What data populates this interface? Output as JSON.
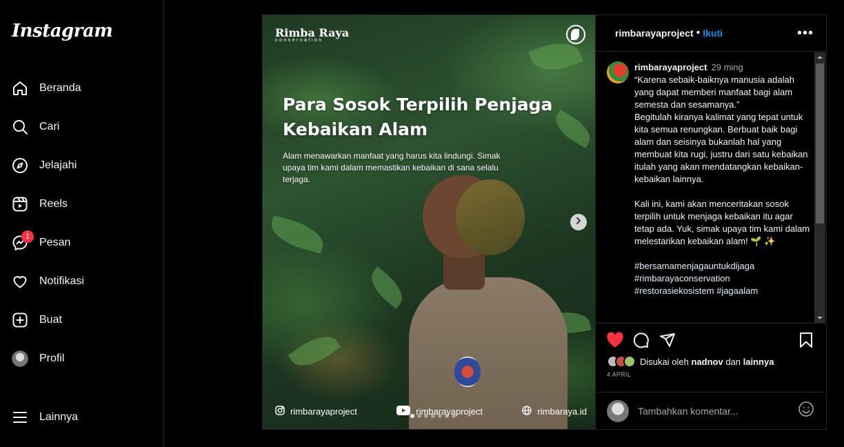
{
  "app": {
    "logo": "Instagram"
  },
  "nav": {
    "items": [
      {
        "label": "Beranda",
        "icon": "home-icon"
      },
      {
        "label": "Cari",
        "icon": "search-icon"
      },
      {
        "label": "Jelajahi",
        "icon": "compass-icon"
      },
      {
        "label": "Reels",
        "icon": "reels-icon"
      },
      {
        "label": "Pesan",
        "icon": "messenger-icon",
        "badge": "1"
      },
      {
        "label": "Notifikasi",
        "icon": "heart-icon"
      },
      {
        "label": "Buat",
        "icon": "plus-square-icon"
      },
      {
        "label": "Profil",
        "icon": "avatar"
      }
    ],
    "more": "Lainnya"
  },
  "post": {
    "username": "rimbarayaproject",
    "follow": "Ikuti",
    "options": "•••",
    "media": {
      "brand": "Rimba Raya",
      "brand_sub": "conservation",
      "headline": "Para Sosok Terpilih Penjaga Kebaikan Alam",
      "subtext": "Alam menawarkan manfaat yang harus kita lindungi. Simak upaya tim kami dalam memastikan kebaikan di sana selalu terjaga.",
      "footer": {
        "instagram": "rimbarayaproject",
        "youtube": "rimbarayaproject",
        "web": "rimbaraya.id"
      }
    },
    "caption": {
      "username": "rimbarayaproject",
      "time": "29 ming",
      "paragraphs": [
        "“Karena sebaik-baiknya manusia adalah yang dapat memberi manfaat bagi alam semesta dan sesamanya.”\nBegitulah kiranya kalimat yang tepat untuk kita semua renungkan. Berbuat baik bagi alam dan seisinya bukanlah hal yang membuat kita rugi, justru dari satu kebaikan itulah yang akan mendatangkan kebaikan-kebaikan lainnya.",
        "Kali ini, kami akan menceritakan sosok terpilih untuk menjaga kebaikan itu agar tetap ada. Yuk, simak upaya tim kami dalam melestarikan kebaikan alam! 🌱 ✨"
      ],
      "hashtags": "#bersamamenjagauntukdijaga\n#rimbarayaconservation\n#restorasiekosistem #jagaalam"
    },
    "likes": {
      "prefix": "Disukai oleh",
      "user": "nadnov",
      "and": "dan",
      "others": "lainnya"
    },
    "date": "4 APRIL",
    "comment_placeholder": "Tambahkan komentar...",
    "colors": {
      "like": "#ff3040",
      "link": "#0095f6"
    }
  }
}
